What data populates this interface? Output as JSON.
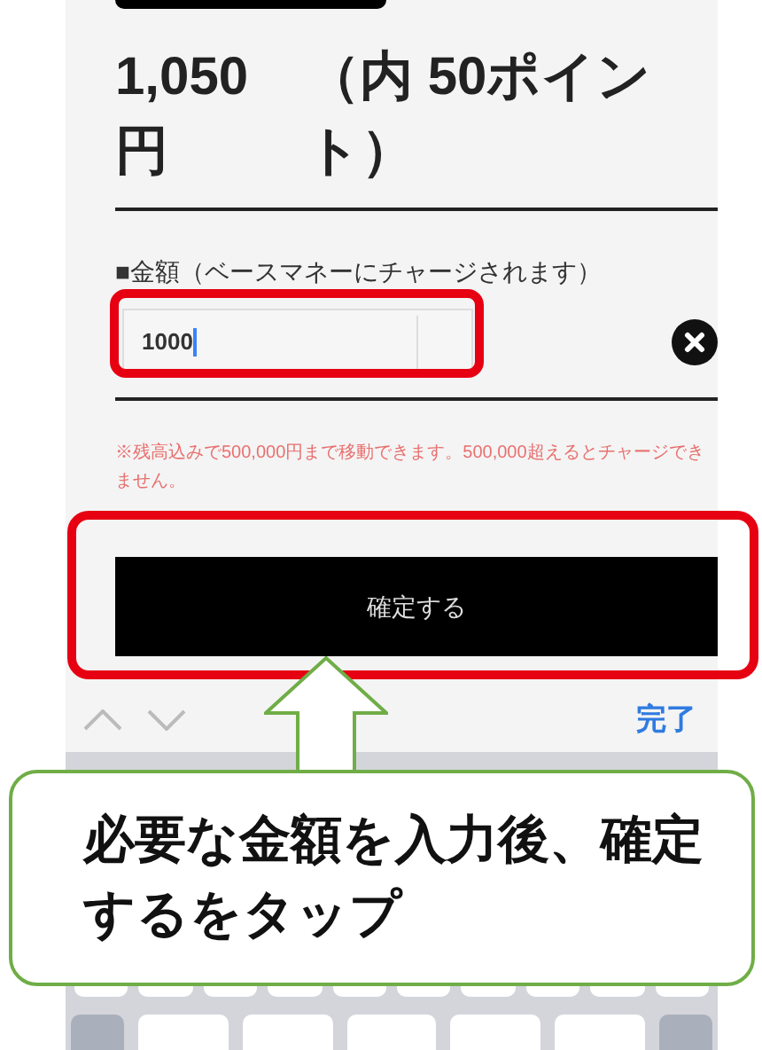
{
  "balance": {
    "amount": "1,050 円",
    "points": "（内 50ポイント）"
  },
  "amount_field": {
    "label": "■金額（ベースマネーにチャージされます）",
    "value": "1000",
    "focused": true
  },
  "note": "※残高込みで500,000円まで移動できます。500,000超えるとチャージできません。",
  "confirm_button": "確定する",
  "keyboard_toolbar": {
    "done": "完了"
  },
  "callout": "必要な金額を入力後、確定するをタップ"
}
